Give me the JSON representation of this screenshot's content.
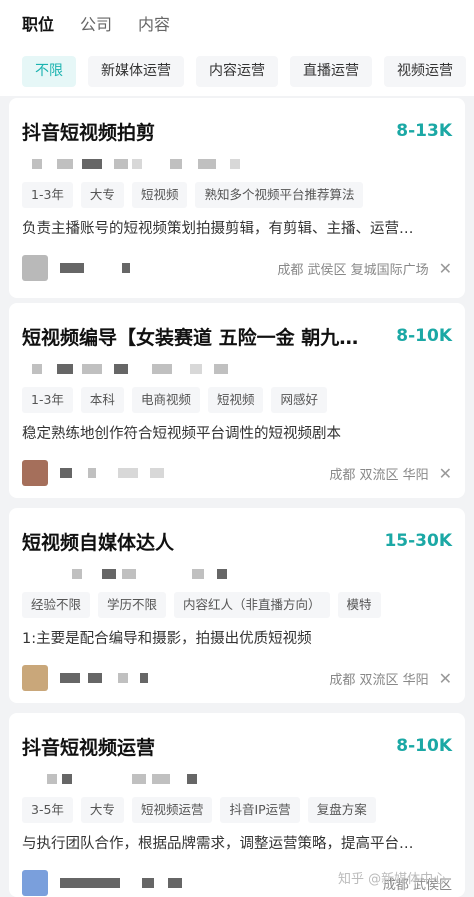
{
  "top_tabs": [
    "职位",
    "公司",
    "内容"
  ],
  "filters": [
    "不限",
    "新媒体运营",
    "内容运营",
    "直播运营",
    "视频运营"
  ],
  "jobs": [
    {
      "title": "抖音短视频拍剪",
      "salary": "8-13K",
      "tags": [
        "1-3年",
        "大专",
        "短视频",
        "熟知多个视频平台推荐算法"
      ],
      "desc": "负责主播账号的短视频策划拍摄剪辑，有剪辑、主播、运营…",
      "location": "成都 武侯区 复城国际广场"
    },
    {
      "title": "短视频编导【女装赛道 五险一金 朝九…",
      "salary": "8-10K",
      "tags": [
        "1-3年",
        "本科",
        "电商视频",
        "短视频",
        "网感好"
      ],
      "desc": "稳定熟练地创作符合短视频平台调性的短视频剧本",
      "location": "成都 双流区 华阳"
    },
    {
      "title": "短视频自媒体达人",
      "salary": "15-30K",
      "tags": [
        "经验不限",
        "学历不限",
        "内容红人（非直播方向）",
        "模特"
      ],
      "desc": "1:主要是配合编导和摄影，拍摄出优质短视频",
      "location": "成都 双流区 华阳"
    },
    {
      "title": "抖音短视频运营",
      "salary": "8-10K",
      "tags": [
        "3-5年",
        "大专",
        "短视频运营",
        "抖音IP运营",
        "复盘方案"
      ],
      "desc": "与执行团队合作，根据品牌需求，调整运营策略，提高平台…",
      "location": "成都 武侯区"
    }
  ],
  "watermark": "知乎 @新媒体中心"
}
